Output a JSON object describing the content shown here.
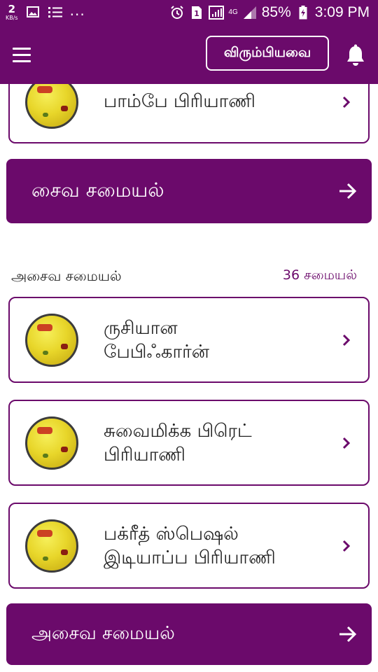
{
  "status_bar": {
    "speed_value": "2",
    "speed_unit": "KB/s",
    "more": "...",
    "network": "4G",
    "battery": "85%",
    "time": "3:09 PM"
  },
  "app_bar": {
    "favorites_label": "விரும்பியவை"
  },
  "top_card": {
    "title": "பாம்பே பிரியாணி"
  },
  "veg_button": {
    "label": "சைவ சமையல்"
  },
  "section": {
    "heading": "அசைவ சமையல்",
    "count": "36 சமையல்"
  },
  "recipes": [
    {
      "title_line1": "ருசியான",
      "title_line2": "பேபிஃகார்ன்"
    },
    {
      "title_line1": "சுவைமிக்க பிரெட்",
      "title_line2": "பிரியாணி"
    },
    {
      "title_line1": "பக்ரீத் ஸ்பெஷல்",
      "title_line2": "இடியாப்ப பிரியாணி"
    }
  ],
  "nonveg_button": {
    "label": "அசைவ சமையல்"
  },
  "colors": {
    "primary": "#6b0a6b",
    "background": "#ffffff"
  }
}
